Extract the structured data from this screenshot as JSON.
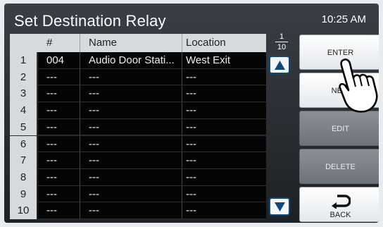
{
  "header": {
    "title": "Set Destination Relay",
    "clock": "10:25 AM"
  },
  "table": {
    "columns": [
      "#",
      "Name",
      "Location"
    ],
    "rows": [
      {
        "index": "1",
        "num": "004",
        "name": "Audio Door Stati...",
        "location": "West Exit"
      },
      {
        "index": "2",
        "num": "---",
        "name": "---",
        "location": "---"
      },
      {
        "index": "3",
        "num": "---",
        "name": "---",
        "location": "---"
      },
      {
        "index": "4",
        "num": "---",
        "name": "---",
        "location": "---"
      },
      {
        "index": "5",
        "num": "---",
        "name": "---",
        "location": "---"
      },
      {
        "index": "6",
        "num": "---",
        "name": "---",
        "location": "---"
      },
      {
        "index": "7",
        "num": "---",
        "name": "---",
        "location": "---"
      },
      {
        "index": "8",
        "num": "---",
        "name": "---",
        "location": "---"
      },
      {
        "index": "9",
        "num": "---",
        "name": "---",
        "location": "---"
      },
      {
        "index": "10",
        "num": "---",
        "name": "---",
        "location": "---"
      }
    ]
  },
  "pager": {
    "current": "1",
    "total": "10"
  },
  "buttons": {
    "enter": "ENTER",
    "new": "NEW",
    "edit": "EDIT",
    "delete": "DELETE",
    "back": "BACK"
  },
  "icons": {
    "scroll_up": "triangle-up-icon",
    "scroll_down": "triangle-down-icon",
    "back": "back-arrow-icon",
    "pointer": "tap-hand-icon"
  },
  "colors": {
    "accent_border": "#0b4a7a",
    "panel_bg": "#2a2e33",
    "disabled_button": "#7a8086"
  }
}
